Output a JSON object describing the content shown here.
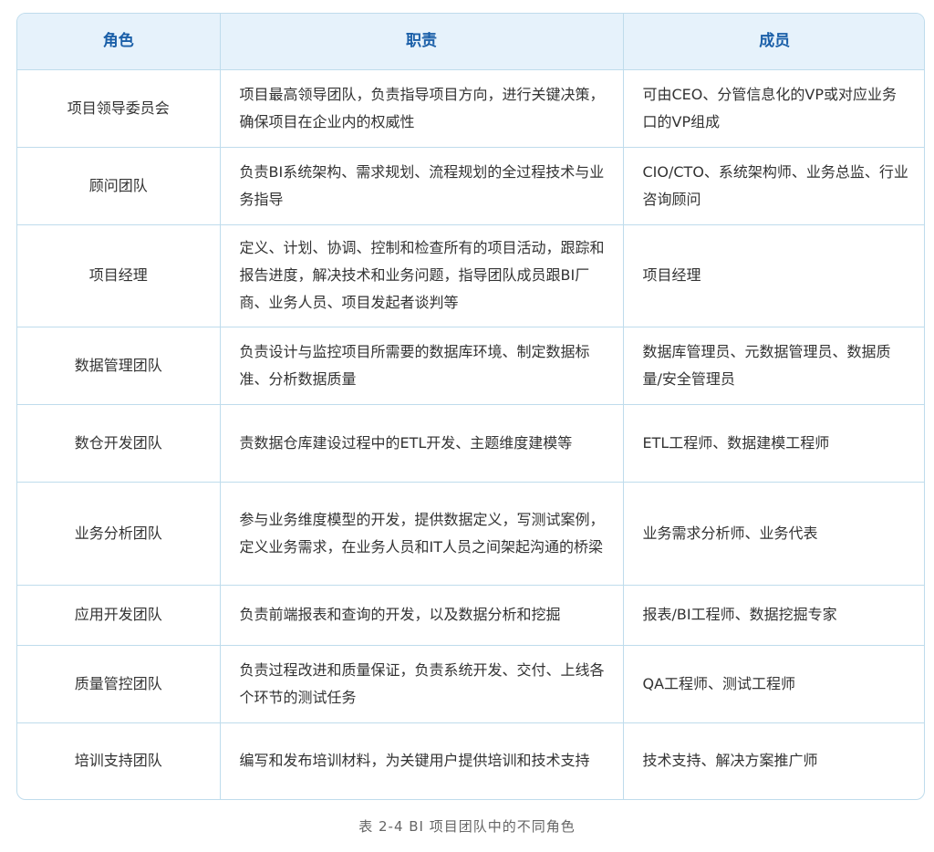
{
  "table": {
    "headers": [
      "角色",
      "职责",
      "成员"
    ],
    "rows": [
      {
        "role": "项目领导委员会",
        "duty": "项目最高领导团队，负责指导项目方向，进行关键决策，确保项目在企业内的权威性",
        "members": "可由CEO、分管信息化的VP或对应业务口的VP组成"
      },
      {
        "role": "顾问团队",
        "duty": "负责BI系统架构、需求规划、流程规划的全过程技术与业务指导",
        "members": "CIO/CTO、系统架构师、业务总监、行业咨询顾问"
      },
      {
        "role": "项目经理",
        "duty": "定义、计划、协调、控制和检查所有的项目活动，跟踪和报告进度，解决技术和业务问题，指导团队成员跟BI厂商、业务人员、项目发起者谈判等",
        "members": "项目经理"
      },
      {
        "role": "数据管理团队",
        "duty": "负责设计与监控项目所需要的数据库环境、制定数据标准、分析数据质量",
        "members": "数据库管理员、元数据管理员、数据质量/安全管理员"
      },
      {
        "role": "数仓开发团队",
        "duty": "责数据仓库建设过程中的ETL开发、主题维度建模等",
        "members": "ETL工程师、数据建模工程师"
      },
      {
        "role": "业务分析团队",
        "duty": "参与业务维度模型的开发，提供数据定义，写测试案例，定义业务需求，在业务人员和IT人员之间架起沟通的桥梁",
        "members": "业务需求分析师、业务代表"
      },
      {
        "role": "应用开发团队",
        "duty": "负责前端报表和查询的开发，以及数据分析和挖掘",
        "members": "报表/BI工程师、数据挖掘专家"
      },
      {
        "role": "质量管控团队",
        "duty": "负责过程改进和质量保证，负责系统开发、交付、上线各个环节的测试任务",
        "members": "QA工程师、测试工程师"
      },
      {
        "role": "培训支持团队",
        "duty": "编写和发布培训材料，为关键用户提供培训和技术支持",
        "members": "技术支持、解决方案推广师"
      }
    ]
  },
  "caption": "表 2-4  BI 项目团队中的不同角色"
}
